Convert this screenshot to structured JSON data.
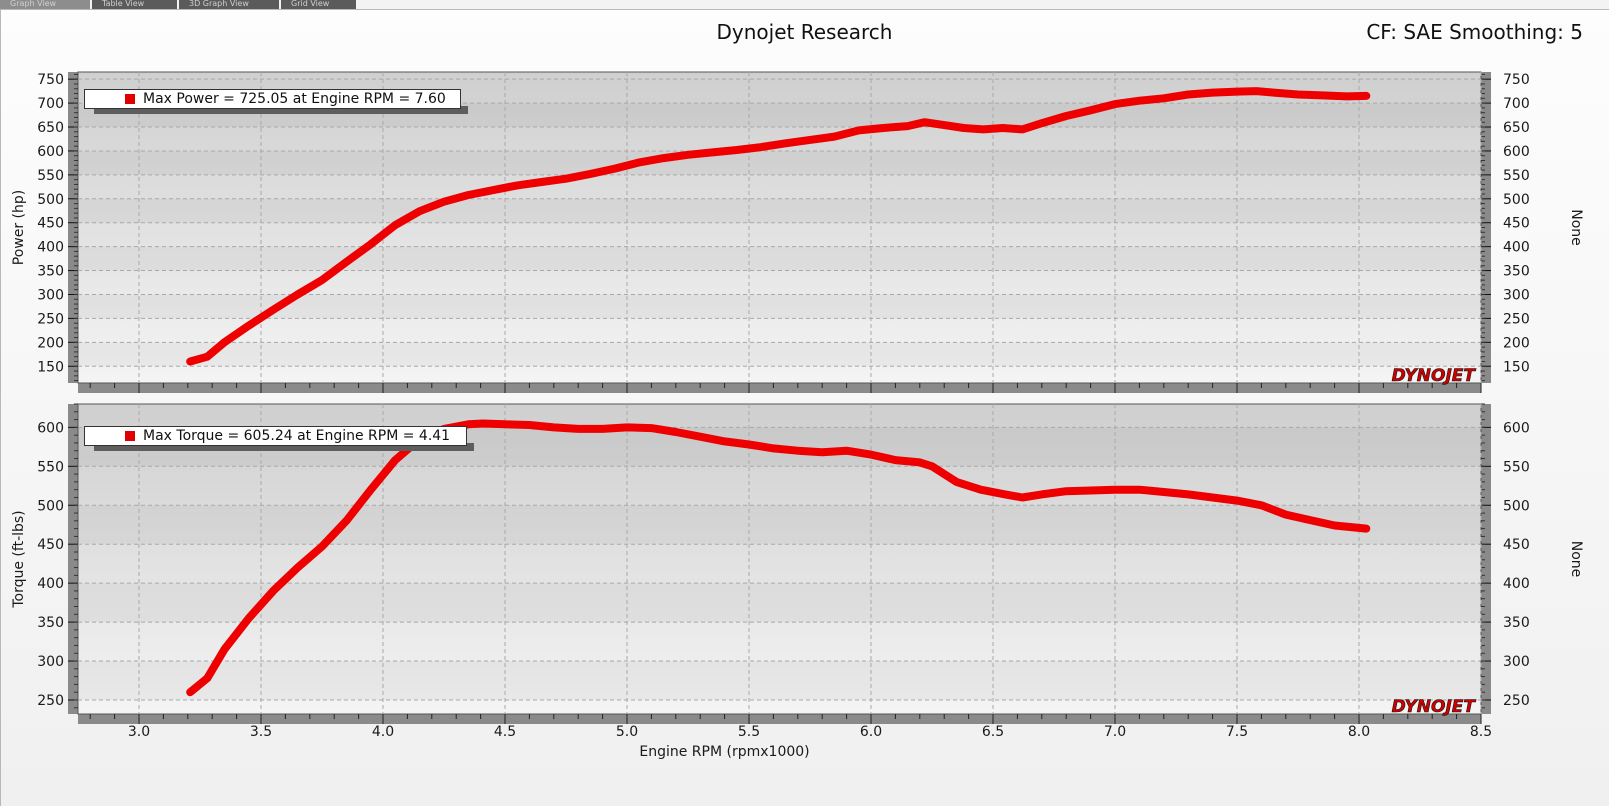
{
  "tabs": [
    "Graph View",
    "Table View",
    "3D Graph View",
    "Grid View"
  ],
  "header": {
    "title": "Dynojet Research",
    "correction": "CF: SAE Smoothing: 5"
  },
  "logo_text": "DYNOJET",
  "colors": {
    "curve": "#ee0000",
    "plot_bg": "#e6e6e6",
    "grid": "#a9a9a9"
  },
  "chart_data": [
    {
      "type": "line",
      "ylabel": "Power (hp)",
      "y2label": "None",
      "xlabel": "",
      "ylim": [
        115,
        765
      ],
      "yticks": [
        150,
        200,
        250,
        300,
        350,
        400,
        450,
        500,
        550,
        600,
        650,
        700,
        750
      ],
      "xlim": [
        2.75,
        8.5
      ],
      "grid": true,
      "legend": "Max Power = 725.05 at Engine RPM = 7.60",
      "series": [
        {
          "x": [
            3.21,
            3.28,
            3.35,
            3.45,
            3.55,
            3.65,
            3.75,
            3.85,
            3.95,
            4.05,
            4.15,
            4.25,
            4.35,
            4.45,
            4.55,
            4.65,
            4.75,
            4.85,
            4.95,
            5.05,
            5.15,
            5.25,
            5.35,
            5.45,
            5.55,
            5.65,
            5.75,
            5.85,
            5.95,
            6.05,
            6.15,
            6.22,
            6.3,
            6.38,
            6.46,
            6.54,
            6.62,
            6.7,
            6.8,
            6.9,
            7.0,
            7.1,
            7.2,
            7.3,
            7.4,
            7.5,
            7.58,
            7.65,
            7.75,
            7.85,
            7.95,
            8.03
          ],
          "y": [
            160,
            170,
            200,
            235,
            268,
            300,
            330,
            368,
            405,
            445,
            474,
            494,
            508,
            518,
            528,
            535,
            542,
            552,
            563,
            576,
            585,
            592,
            597,
            602,
            608,
            616,
            623,
            630,
            643,
            648,
            652,
            660,
            654,
            648,
            645,
            648,
            645,
            658,
            673,
            685,
            698,
            705,
            710,
            718,
            722,
            724,
            725,
            722,
            718,
            716,
            714,
            715
          ]
        }
      ]
    },
    {
      "type": "line",
      "ylabel": "Torque (ft-lbs)",
      "y2label": "None",
      "xlabel": "Engine RPM (rpmx1000)",
      "ylim": [
        232,
        630
      ],
      "yticks": [
        250,
        300,
        350,
        400,
        450,
        500,
        550,
        600
      ],
      "xlim": [
        2.75,
        8.5
      ],
      "xticks": [
        "3.0",
        "3.5",
        "4.0",
        "4.5",
        "5.0",
        "5.5",
        "6.0",
        "6.5",
        "7.0",
        "7.5",
        "8.0",
        "8.5"
      ],
      "grid": true,
      "legend": "Max Torque = 605.24 at Engine RPM = 4.41",
      "series": [
        {
          "x": [
            3.21,
            3.28,
            3.35,
            3.45,
            3.55,
            3.65,
            3.75,
            3.85,
            3.95,
            4.05,
            4.15,
            4.25,
            4.35,
            4.41,
            4.5,
            4.6,
            4.7,
            4.8,
            4.9,
            5.0,
            5.1,
            5.2,
            5.3,
            5.4,
            5.5,
            5.6,
            5.7,
            5.8,
            5.9,
            6.0,
            6.1,
            6.2,
            6.25,
            6.35,
            6.45,
            6.55,
            6.62,
            6.7,
            6.8,
            6.9,
            7.0,
            7.1,
            7.2,
            7.3,
            7.4,
            7.5,
            7.6,
            7.7,
            7.8,
            7.9,
            8.03
          ],
          "y": [
            260,
            278,
            315,
            355,
            390,
            420,
            447,
            480,
            520,
            558,
            585,
            598,
            604,
            605,
            604,
            603,
            600,
            598,
            598,
            600,
            599,
            594,
            588,
            582,
            578,
            573,
            570,
            568,
            570,
            565,
            558,
            555,
            550,
            530,
            520,
            514,
            510,
            514,
            518,
            519,
            520,
            520,
            517,
            514,
            510,
            506,
            500,
            488,
            481,
            474,
            470
          ]
        }
      ]
    }
  ]
}
